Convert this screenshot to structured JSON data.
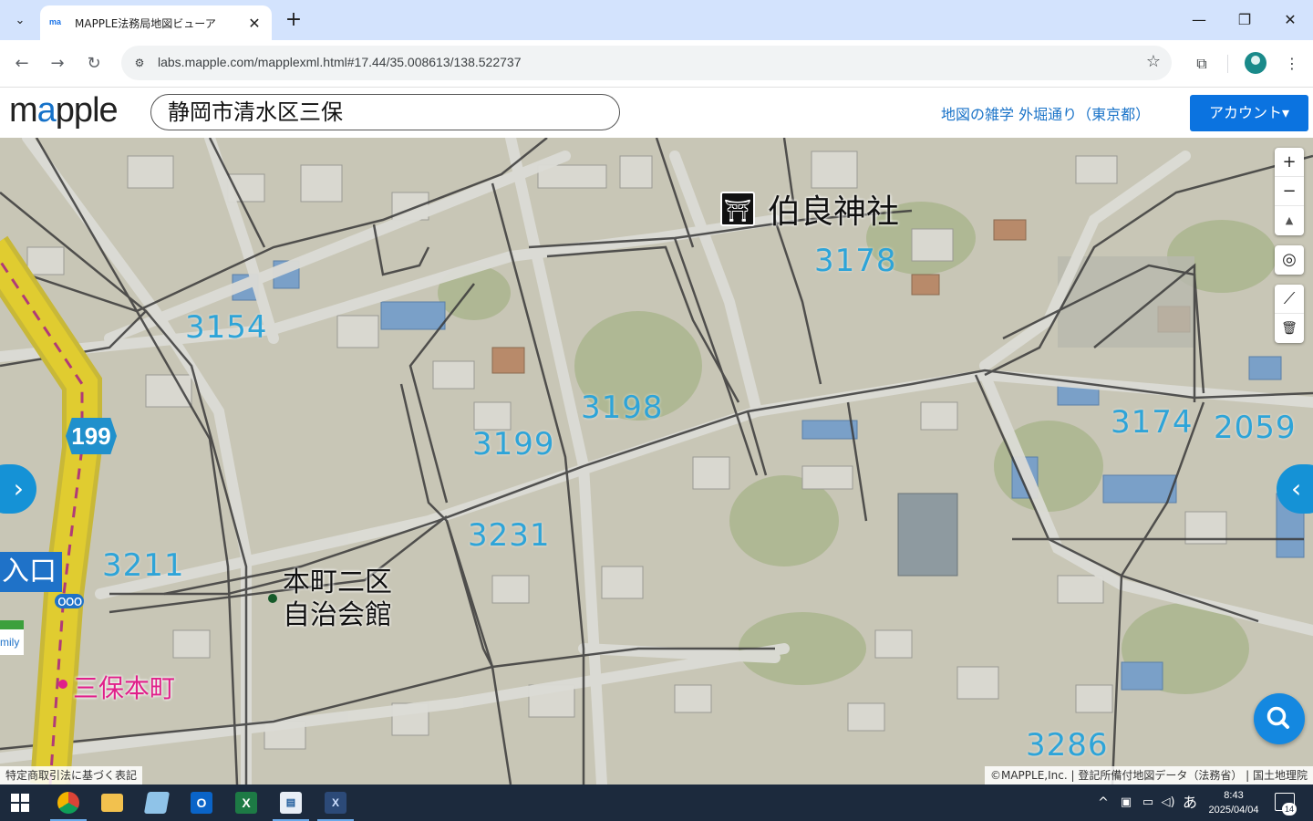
{
  "browser": {
    "tab_title": "MAPPLE法務局地図ビューア",
    "tab_favicon": "ma",
    "url": "labs.mapple.com/mapplexml.html#17.44/35.008613/138.522737",
    "colors": {
      "tabbar_bg": "#d3e3fd",
      "profile": "#1a8a8a"
    }
  },
  "header": {
    "logo_pre": "m",
    "logo_accent": "a",
    "logo_post": "pple",
    "search_value": "静岡市清水区三保",
    "trivia_link": "地図の雑学 外堀通り（東京都）",
    "account_button": "アカウント▾",
    "colors": {
      "accent": "#0b73e0",
      "link": "#1a73c8"
    }
  },
  "map": {
    "parcels": [
      "3178",
      "3154",
      "3198",
      "3199",
      "3174",
      "2059",
      "3231",
      "3211",
      "3286"
    ],
    "shrine": {
      "icon": "⛩",
      "name": "伯良神社"
    },
    "community_hall": {
      "line1": "本町二区",
      "line2": "自治会館"
    },
    "bus_stop": {
      "name": "三保本町"
    },
    "route_number": "199",
    "entrance_label": "入口",
    "store_label": "mily",
    "controls": {
      "zoom_in": "+",
      "zoom_out": "−",
      "compass": "▲",
      "locate": "◎",
      "measure": "⟋",
      "delete": "🗑"
    },
    "attribution_left": "特定商取引法に基づく表記",
    "attribution_right": "©MAPPLE,Inc. | 登記所備付地図データ（法務省） | 国土地理院",
    "colors": {
      "parcel_number": "#2ea4d8",
      "bus_stop": "#e0208a",
      "panel_button": "#1592d6",
      "route_shield": "#2090cc",
      "highway": "#d8c020"
    }
  },
  "taskbar": {
    "time": "8:43",
    "date": "2025/04/04",
    "ime": "あ",
    "notification_count": "14",
    "apps": [
      "chrome-icon",
      "file-explorer-icon",
      "notepad-icon",
      "outlook-icon",
      "excel-icon",
      "document-icon",
      "xml-tool-icon"
    ]
  }
}
